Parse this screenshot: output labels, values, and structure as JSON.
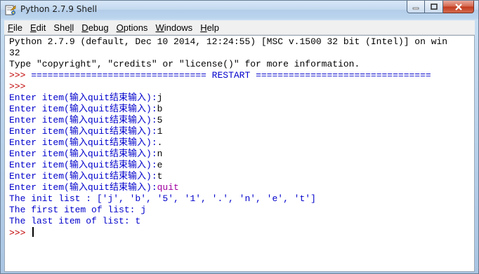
{
  "window": {
    "title": "Python 2.7.9 Shell",
    "app_icon": "python-idle-icon",
    "controls": [
      "minimize-icon",
      "maximize-icon",
      "close-icon"
    ]
  },
  "menubar": {
    "items": [
      {
        "label": "File",
        "mnemonic": "F",
        "rest": "ile"
      },
      {
        "label": "Edit",
        "mnemonic": "E",
        "rest": "dit"
      },
      {
        "label": "Shell",
        "pre": "She",
        "mnemonic": "l",
        "rest": "l"
      },
      {
        "label": "Debug",
        "mnemonic": "D",
        "rest": "ebug"
      },
      {
        "label": "Options",
        "mnemonic": "O",
        "rest": "ptions"
      },
      {
        "label": "Windows",
        "mnemonic": "W",
        "rest": "indows"
      },
      {
        "label": "Help",
        "mnemonic": "H",
        "rest": "elp"
      }
    ]
  },
  "shell": {
    "banner_line1": "Python 2.7.9 (default, Dec 10 2014, 12:24:55) [MSC v.1500 32 bit (Intel)] on win",
    "banner_line2": "32",
    "banner_line3": "Type \"copyright\", \"credits\" or \"license()\" for more information.",
    "restart_prompt": ">>> ",
    "restart_text": "================================ RESTART ================================",
    "empty_prompt": ">>> ",
    "input_prompt": "Enter item(输入quit结束输入):",
    "inputs": [
      "j",
      "b",
      "5",
      "1",
      ".",
      "n",
      "e",
      "t",
      "quit"
    ],
    "out_init": "The init list : ['j', 'b', '5', '1', '.', 'n', 'e', 't']",
    "out_first": "The first item of list: j",
    "out_last": "The last item of list: t",
    "final_prompt": ">>> "
  },
  "colors": {
    "prompt": "#c00000",
    "stdout": "#0000cc",
    "stdin": "#000000",
    "input_quit": "#a000a0"
  }
}
